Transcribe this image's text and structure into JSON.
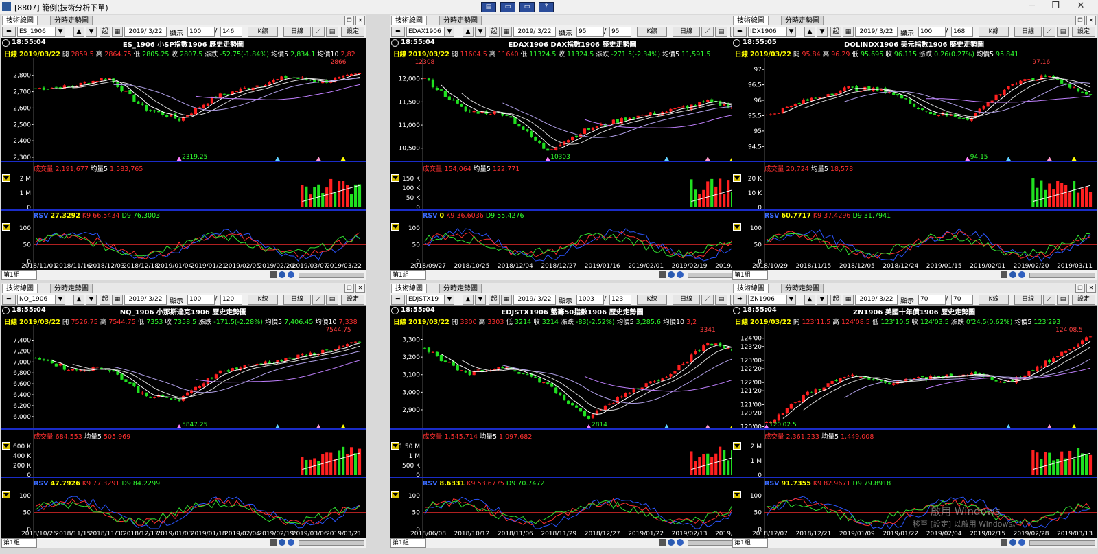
{
  "window": {
    "title": "[8807] 範例(技術分析下單)",
    "toolbar_buttons": [
      "▤",
      "▭",
      "▭",
      "?"
    ]
  },
  "panels": [
    {
      "tab_active": "技術線圖",
      "tab_other": "分時走勢圖",
      "symbol_input": "ES_1906",
      "mode_btn": "起",
      "date_input": "2019/ 3/22",
      "display_label": "顯示",
      "display_value": "100",
      "display_total": "146",
      "kline_btn": "K線",
      "period_btn": "日線",
      "settings_btn": "設定",
      "clock": "18:55:04",
      "title": "ES_1906 小SP指數1906 歷史走勢圖",
      "info": {
        "period": "日線",
        "date": "2019/03/22",
        "open": "2859.5",
        "high": "2864.75",
        "low": "2805.25",
        "close": "2807.5",
        "change": "-52.75(-1.84%)",
        "ma5": "2,834.1",
        "ma10": "2,82"
      },
      "info_labels": {
        "open": "開",
        "high": "高",
        "low": "低",
        "close": "收",
        "change": "漲跌",
        "ma5": "均價5",
        "ma10": "均價10"
      },
      "price_ticks": [
        "2,800",
        "2,700",
        "2,600",
        "2,500",
        "2,400",
        "2,300"
      ],
      "high_label": "2866",
      "low_label": "2319.25",
      "volume": {
        "label": "成交量",
        "value": "2,191,677",
        "ma_label": "均量5",
        "ma_value": "1,583,765",
        "ticks": [
          "2 M",
          "1 M",
          "0"
        ]
      },
      "kd": {
        "rsv_label": "RSV",
        "rsv": "27.3292",
        "k_label": "K9",
        "k": "66.5434",
        "d_label": "D9",
        "d": "76.3003",
        "ticks": [
          "100",
          "50",
          "0"
        ]
      },
      "dates": [
        "2018/11/01",
        "2018/11/16",
        "2018/12/03",
        "2018/12/18",
        "2019/01/04",
        "2019/01/21",
        "2019/02/05",
        "2019/02/20",
        "2019/03/07",
        "2019/03/22"
      ],
      "group": "第1組"
    },
    {
      "tab_active": "技術線圖",
      "tab_other": "分時走勢圖",
      "symbol_input": "EDAX1906",
      "mode_btn": "起",
      "date_input": "2019/ 3/22",
      "display_label": "顯示",
      "display_value": "95",
      "display_total": "95",
      "kline_btn": "K線",
      "period_btn": "日線",
      "settings_btn": "設定",
      "clock": "18:55:04",
      "title": "EDAX1906 DAX指數1906 歷史走勢圖",
      "info": {
        "period": "日線",
        "date": "2019/03/22",
        "open": "11604.5",
        "high": "11640",
        "low": "11324.5",
        "close": "11324.5",
        "change": "-271.5(-2.34%)",
        "ma5": "11,591.5",
        "ma10": ""
      },
      "info_labels": {
        "open": "開",
        "high": "高",
        "low": "低",
        "close": "收",
        "change": "漲跌",
        "ma5": "均價5",
        "ma10": ""
      },
      "price_ticks": [
        "12,000",
        "11,500",
        "11,000",
        "10,500"
      ],
      "high_label": "12308",
      "low_label": "10303",
      "volume": {
        "label": "成交量",
        "value": "154,064",
        "ma_label": "均量5",
        "ma_value": "122,771",
        "ticks": [
          "150 K",
          "100 K",
          "50 K",
          "0"
        ]
      },
      "kd": {
        "rsv_label": "RSV",
        "rsv": "0",
        "k_label": "K9",
        "k": "36.6036",
        "d_label": "D9",
        "d": "55.4276",
        "ticks": [
          "100",
          "50",
          "0"
        ]
      },
      "dates": [
        "2018/09/27",
        "2018/10/25",
        "2018/12/04",
        "2018/12/27",
        "2019/01/16",
        "2019/02/01",
        "2019/02/19",
        "2019/03/07"
      ],
      "group": "第1組"
    },
    {
      "tab_active": "技術線圖",
      "tab_other": "分時走勢圖",
      "symbol_input": "IDX1906",
      "mode_btn": "起",
      "date_input": "2019/ 3/22",
      "display_label": "顯示",
      "display_value": "100",
      "display_total": "168",
      "kline_btn": "K線",
      "period_btn": "日線",
      "settings_btn": "設定",
      "clock": "18:55:05",
      "title": "DOLINDX1906 美元指數1906 歷史走勢圖",
      "info": {
        "period": "日線",
        "date": "2019/03/22",
        "open": "95.84",
        "high": "96.29",
        "low": "95.695",
        "close": "96.115",
        "change": "0.26(0.27%)",
        "ma5": "95.841",
        "ma10": ""
      },
      "info_labels": {
        "open": "開",
        "high": "高",
        "low": "低",
        "close": "收",
        "change": "漲跌",
        "ma5": "均價5",
        "ma10": ""
      },
      "price_ticks": [
        "97",
        "96.5",
        "96",
        "95.5",
        "95",
        "94.5",
        "94"
      ],
      "high_label": "97.16",
      "low_label": "94.15",
      "volume": {
        "label": "成交量",
        "value": "20,724",
        "ma_label": "均量5",
        "ma_value": "18,578",
        "ticks": [
          "20 K",
          "10 K",
          "0"
        ]
      },
      "kd": {
        "rsv_label": "RSV",
        "rsv": "60.7717",
        "k_label": "K9",
        "k": "37.4296",
        "d_label": "D9",
        "d": "31.7941",
        "ticks": [
          "100",
          "50",
          "0"
        ]
      },
      "dates": [
        "2018/10/29",
        "2018/11/15",
        "2018/12/05",
        "2018/12/24",
        "2019/01/15",
        "2019/02/01",
        "2019/02/20",
        "2019/03/11"
      ],
      "group": "第1組"
    },
    {
      "tab_active": "技術線圖",
      "tab_other": "分時走勢圖",
      "symbol_input": "NQ_1906",
      "mode_btn": "起",
      "date_input": "2019/ 3/22",
      "display_label": "顯示",
      "display_value": "100",
      "display_total": "120",
      "kline_btn": "K線",
      "period_btn": "日線",
      "settings_btn": "設定",
      "clock": "18:55:04",
      "title": "NQ_1906 小那斯達克1906 歷史走勢圖",
      "info": {
        "period": "日線",
        "date": "2019/03/22",
        "open": "7526.75",
        "high": "7544.75",
        "low": "7353",
        "close": "7358.5",
        "change": "-171.5(-2.28%)",
        "ma5": "7,406.45",
        "ma10": "7,338"
      },
      "info_labels": {
        "open": "開",
        "high": "高",
        "low": "低",
        "close": "收",
        "change": "漲跌",
        "ma5": "均價5",
        "ma10": "均價10"
      },
      "price_ticks": [
        "7,400",
        "7,200",
        "7,000",
        "6,800",
        "6,600",
        "6,400",
        "6,200",
        "6,000",
        "5,800"
      ],
      "high_label": "7544.75",
      "low_label": "5847.25",
      "volume": {
        "label": "成交量",
        "value": "684,553",
        "ma_label": "均量5",
        "ma_value": "505,969",
        "ticks": [
          "600 K",
          "400 K",
          "200 K",
          "0"
        ]
      },
      "kd": {
        "rsv_label": "RSV",
        "rsv": "47.7926",
        "k_label": "K9",
        "k": "77.3291",
        "d_label": "D9",
        "d": "84.2299",
        "ticks": [
          "100",
          "50",
          "0"
        ]
      },
      "dates": [
        "2018/10/26",
        "2018/11/15",
        "2018/11/30",
        "2018/12/17",
        "2019/01/03",
        "2019/01/18",
        "2019/02/04",
        "2019/02/19",
        "2019/03/06",
        "2019/03/21"
      ],
      "group": "第1組"
    },
    {
      "tab_active": "技術線圖",
      "tab_other": "分時走勢圖",
      "symbol_input": "EDJSTX19",
      "mode_btn": "起",
      "date_input": "2019/ 3/22",
      "display_label": "顯示",
      "display_value": "1003",
      "display_total": "123",
      "kline_btn": "K線",
      "period_btn": "日線",
      "settings_btn": "設定",
      "clock": "18:55:04",
      "title": "EDJSTX1906 藍籌50指數1906 歷史走勢圖",
      "info": {
        "period": "日線",
        "date": "2019/03/22",
        "open": "3300",
        "high": "3303",
        "low": "3214",
        "close": "3214",
        "change": "-83(-2.52%)",
        "ma5": "3,285.6",
        "ma10": "3,2"
      },
      "info_labels": {
        "open": "開",
        "high": "高",
        "low": "低",
        "close": "收",
        "change": "漲跌",
        "ma5": "均價5",
        "ma10": "均價10"
      },
      "price_ticks": [
        "3,300",
        "3,200",
        "3,100",
        "3,000",
        "2,900",
        "2,800"
      ],
      "high_label": "3341",
      "low_label": "2814",
      "volume": {
        "label": "成交量",
        "value": "1,545,714",
        "ma_label": "均量5",
        "ma_value": "1,097,682",
        "ticks": [
          "1.50 M",
          "1 M",
          "500 K",
          "0"
        ]
      },
      "kd": {
        "rsv_label": "RSV",
        "rsv": "8.6331",
        "k_label": "K9",
        "k": "53.6775",
        "d_label": "D9",
        "d": "70.7472",
        "ticks": [
          "100",
          "50",
          "0"
        ]
      },
      "dates": [
        "2018/06/08",
        "2018/10/12",
        "2018/11/06",
        "2018/11/29",
        "2018/12/27",
        "2019/01/22",
        "2019/02/13",
        "2019/03/07"
      ],
      "group": "第1組"
    },
    {
      "tab_active": "技術線圖",
      "tab_other": "分時走勢圖",
      "symbol_input": "ZN1906",
      "mode_btn": "起",
      "date_input": "2019/ 3/22",
      "display_label": "顯示",
      "display_value": "70",
      "display_total": "70",
      "kline_btn": "K線",
      "period_btn": "日線",
      "settings_btn": "設定",
      "clock": "18:55:04",
      "title": "ZN1906 美國十年債1906 歷史走勢圖",
      "info": {
        "period": "日線",
        "date": "2019/03/22",
        "open": "123'11.5",
        "high": "124'08.5",
        "low": "123'10.5",
        "close": "124'03.5",
        "change": "0'24.5(0.62%)",
        "ma5": "123'293",
        "ma10": ""
      },
      "info_labels": {
        "open": "開",
        "high": "高",
        "low": "低",
        "close": "收",
        "change": "漲跌",
        "ma5": "均價5",
        "ma10": ""
      },
      "price_ticks": [
        "124'00",
        "123'20",
        "123'00",
        "122'20",
        "122'00",
        "121'20",
        "121'00",
        "120'20",
        "120'00"
      ],
      "high_label": "124'08.5",
      "low_label": "120'02.5",
      "volume": {
        "label": "成交量",
        "value": "2,361,233",
        "ma_label": "均量5",
        "ma_value": "1,449,008",
        "ticks": [
          "2 M",
          "1 M",
          "0"
        ]
      },
      "kd": {
        "rsv_label": "RSV",
        "rsv": "91.7355",
        "k_label": "K9",
        "k": "82.9671",
        "d_label": "D9",
        "d": "79.8918",
        "ticks": [
          "100",
          "50",
          "0"
        ]
      },
      "dates": [
        "2018/12/07",
        "2018/12/21",
        "2019/01/09",
        "2019/01/22",
        "2019/02/04",
        "2019/02/15",
        "2019/02/28",
        "2019/03/13"
      ],
      "group": "第1組"
    }
  ],
  "watermark": {
    "line1": "啟用 Windows",
    "line2": "移至 [設定] 以啟用 Windows。"
  },
  "colors": {
    "up": "#ff2020",
    "down": "#20e020",
    "axis": "#1a2cc8",
    "bg": "#000000"
  },
  "chart_data": [
    {
      "type": "line",
      "title": "ES_1906 小SP指數1906 歷史走勢圖",
      "x": [
        "2018/11/01",
        "2018/11/16",
        "2018/12/03",
        "2018/12/18",
        "2019/01/04",
        "2019/01/21",
        "2019/02/05",
        "2019/02/20",
        "2019/03/07",
        "2019/03/22"
      ],
      "series": [
        {
          "name": "收",
          "values": [
            2720,
            2730,
            2790,
            2600,
            2530,
            2670,
            2730,
            2790,
            2760,
            2807.5
          ]
        }
      ],
      "ylim": [
        2300,
        2866
      ]
    },
    {
      "type": "line",
      "title": "EDAX1906 DAX指數1906 歷史走勢圖",
      "x": [
        "2018/09/27",
        "2018/10/25",
        "2018/12/04",
        "2018/12/27",
        "2019/01/16",
        "2019/02/01",
        "2019/02/19",
        "2019/03/07",
        "2019/03/22"
      ],
      "series": [
        {
          "name": "收",
          "values": [
            12000,
            11300,
            11250,
            10450,
            10900,
            11150,
            11300,
            11500,
            11324.5
          ]
        }
      ],
      "ylim": [
        10303,
        12308
      ]
    },
    {
      "type": "line",
      "title": "DOLINDX1906 美元指數1906 歷史走勢圖",
      "x": [
        "2018/10/29",
        "2018/11/15",
        "2018/12/05",
        "2018/12/24",
        "2019/01/15",
        "2019/02/01",
        "2019/02/20",
        "2019/03/11",
        "2019/03/22"
      ],
      "series": [
        {
          "name": "收",
          "values": [
            95.5,
            96.0,
            96.4,
            96.3,
            95.6,
            95.4,
            96.5,
            96.8,
            96.115
          ]
        }
      ],
      "ylim": [
        94.15,
        97.16
      ]
    },
    {
      "type": "line",
      "title": "NQ_1906 小那斯達克1906 歷史走勢圖",
      "x": [
        "2018/10/26",
        "2018/11/15",
        "2018/11/30",
        "2018/12/17",
        "2019/01/03",
        "2019/01/18",
        "2019/02/04",
        "2019/02/19",
        "2019/03/06",
        "2019/03/21"
      ],
      "series": [
        {
          "name": "收",
          "values": [
            7100,
            6850,
            6900,
            6400,
            6300,
            6800,
            6950,
            7050,
            7200,
            7358.5
          ]
        }
      ],
      "ylim": [
        5847.25,
        7544.75
      ]
    },
    {
      "type": "line",
      "title": "EDJSTX1906 藍籌50指數1906 歷史走勢圖",
      "x": [
        "2018/06/08",
        "2018/10/12",
        "2018/11/06",
        "2018/11/29",
        "2018/12/27",
        "2019/01/22",
        "2019/02/13",
        "2019/03/07",
        "2019/03/22"
      ],
      "series": [
        {
          "name": "收",
          "values": [
            3250,
            3100,
            3150,
            3050,
            2850,
            3000,
            3100,
            3280,
            3214
          ]
        }
      ],
      "ylim": [
        2814,
        3341
      ]
    },
    {
      "type": "line",
      "title": "ZN1906 美國十年債1906 歷史走勢圖",
      "x": [
        "2018/12/07",
        "2018/12/21",
        "2019/01/09",
        "2019/01/22",
        "2019/02/04",
        "2019/02/15",
        "2019/02/28",
        "2019/03/13",
        "2019/03/22"
      ],
      "series": [
        {
          "name": "收",
          "values": [
            120.1,
            121.5,
            122.3,
            122.0,
            122.2,
            122.4,
            122.0,
            123.0,
            124.1
          ]
        }
      ],
      "ylim": [
        120.08,
        124.27
      ]
    }
  ]
}
